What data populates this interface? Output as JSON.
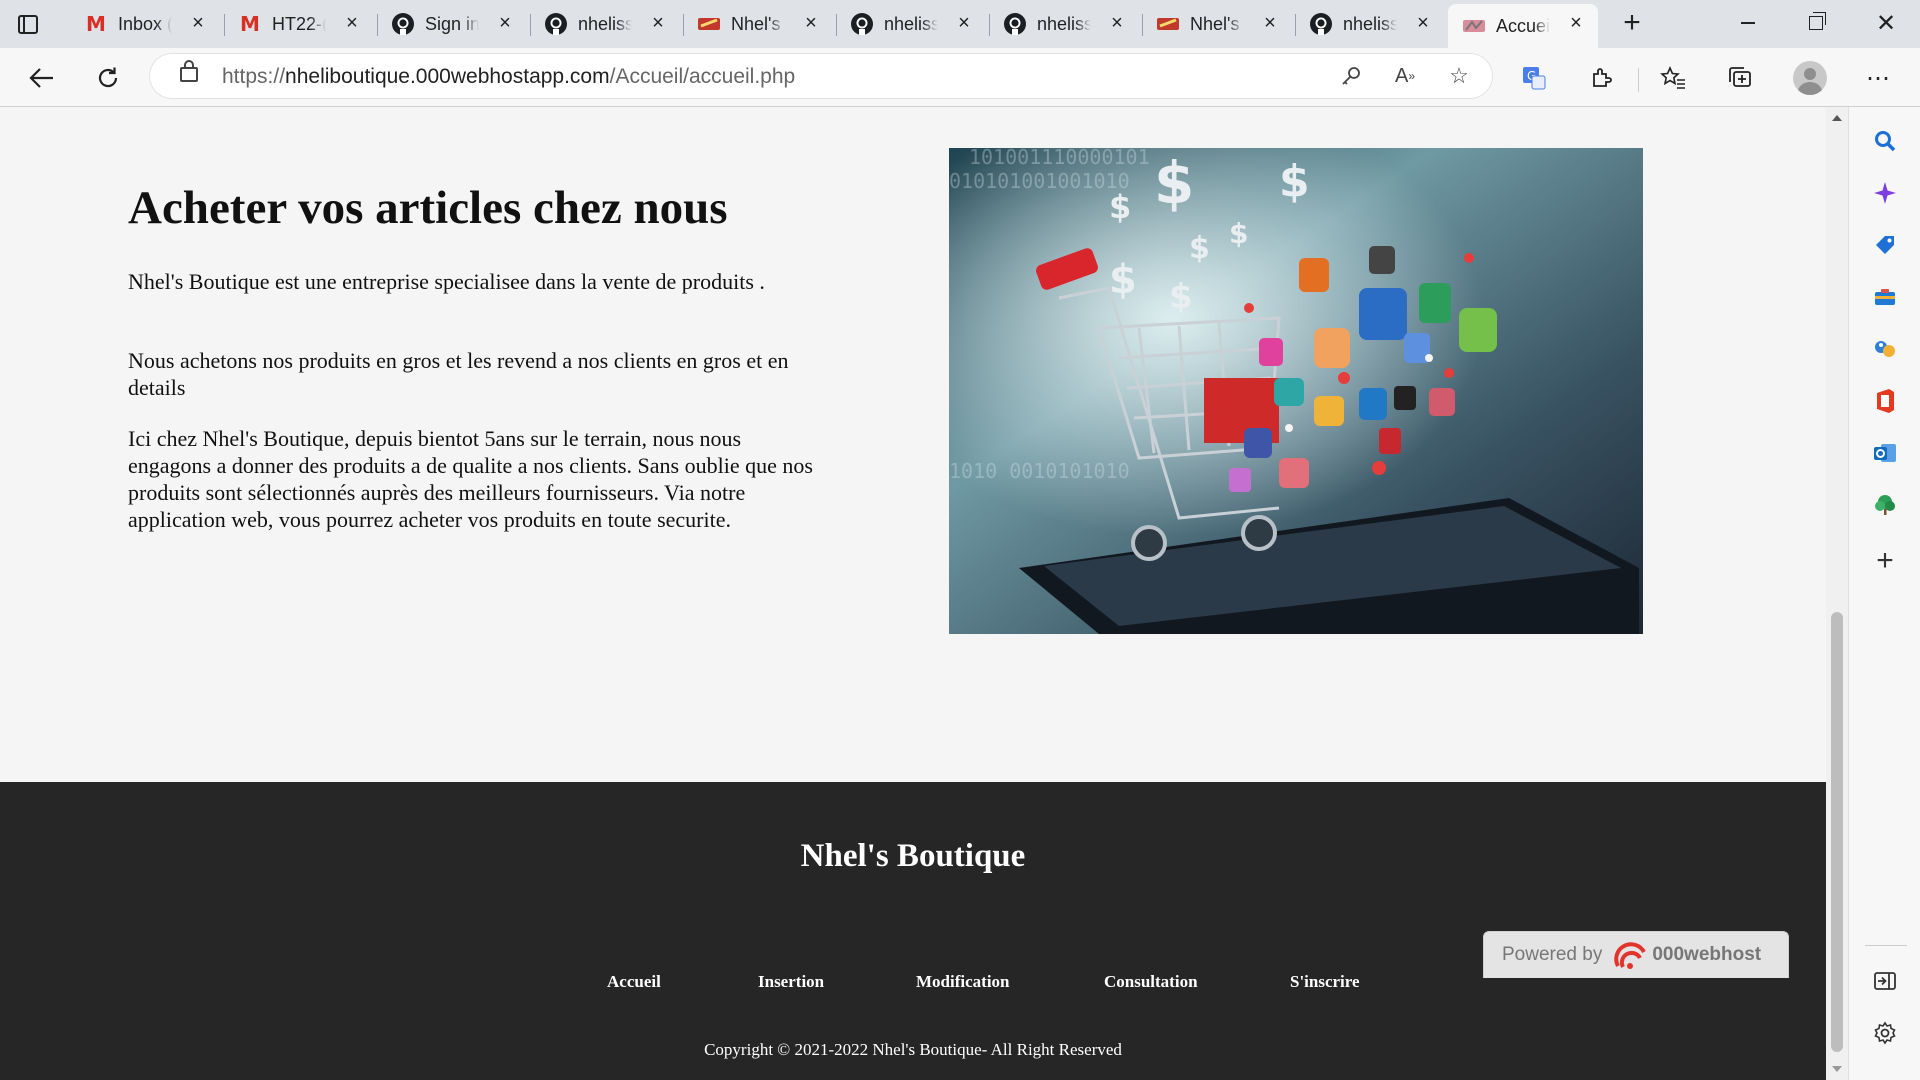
{
  "browser": {
    "tabs": [
      {
        "label": "Inbox (",
        "icon": "gmail-icon"
      },
      {
        "label": "HT22-(",
        "icon": "gmail-icon"
      },
      {
        "label": "Sign in",
        "icon": "github-icon"
      },
      {
        "label": "nheliss",
        "icon": "github-icon"
      },
      {
        "label": "Nhel's",
        "icon": "site-icon"
      },
      {
        "label": "nheliss",
        "icon": "github-icon"
      },
      {
        "label": "nheliss",
        "icon": "github-icon"
      },
      {
        "label": "Nhel's",
        "icon": "site-icon"
      },
      {
        "label": "nheliss",
        "icon": "github-icon"
      },
      {
        "label": "Accuei",
        "icon": "site-icon",
        "active": true
      }
    ],
    "url": {
      "scheme": "https://",
      "host": "nheliboutique.000webhostapp.com",
      "path": "/Accueil/accueil.php"
    },
    "accent_color": "#0f6cbd"
  },
  "page": {
    "hero": {
      "title": "Acheter vos articles chez nous",
      "paragraphs": [
        "Nhel's Boutique est une entreprise specialisee dans la vente de produits .",
        "Nous achetons nos produits en gros et les revend a nos clients en gros et en details",
        "Ici chez Nhel's Boutique, depuis bientot 5ans sur le terrain, nous nous engagons a donner des produits a de qualite a nos clients. Sans oublie que nos produits sont sélectionnés auprès des meilleurs fournisseurs. Via notre application web, vous pourrez acheter vos produits en toute securite."
      ]
    },
    "footer": {
      "brand": "Nhel's Boutique",
      "nav": [
        "Accueil",
        "Insertion",
        "Modification",
        "Consultation",
        "S'inscrire"
      ],
      "copyright": "Copyright © 2021-2022 Nhel's Boutique- All Right Reserved",
      "background": "#262626"
    },
    "powered_by": {
      "label": "Powered by",
      "name": "000webhost"
    }
  }
}
